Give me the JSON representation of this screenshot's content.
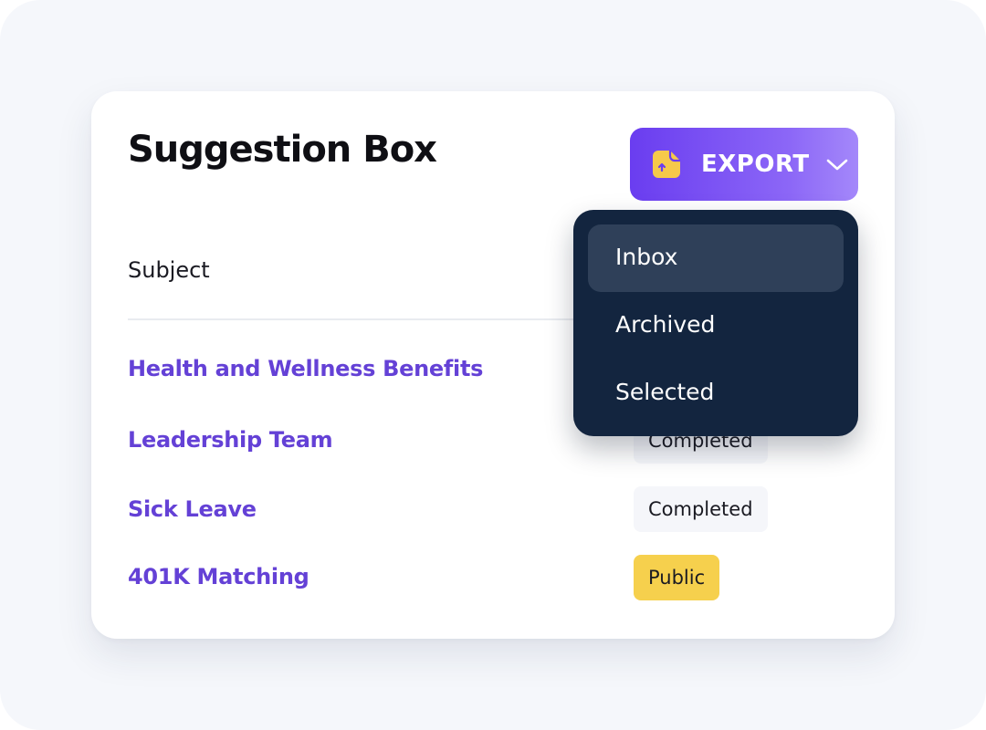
{
  "title": "Suggestion Box",
  "export_button": {
    "label": "EXPORT",
    "icon": "document-upload-icon",
    "chevron_icon": "chevron-down-icon"
  },
  "table": {
    "column_header": "Subject",
    "rows": [
      {
        "subject": "Health and Wellness Benefits",
        "status": ""
      },
      {
        "subject": "Leadership Team",
        "status": "Completed"
      },
      {
        "subject": "Sick Leave",
        "status": "Completed"
      },
      {
        "subject": "401K Matching",
        "status": "Public"
      }
    ]
  },
  "dropdown": {
    "items": [
      {
        "label": "Inbox",
        "highlighted": true
      },
      {
        "label": "Archived",
        "highlighted": false
      },
      {
        "label": "Selected",
        "highlighted": false
      }
    ]
  },
  "colors": {
    "accent": "#6a3df0",
    "subject_link": "#6441d6",
    "menu_bg": "#13253f",
    "public_badge": "#f6d04d"
  }
}
